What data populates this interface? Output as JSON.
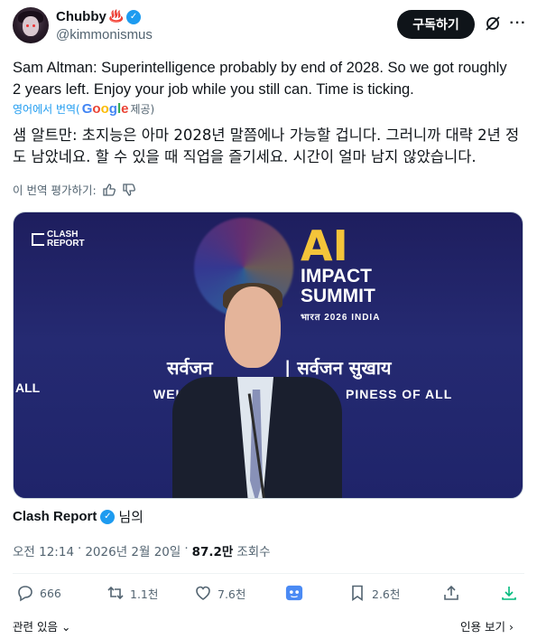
{
  "author": {
    "display_name": "Chubby",
    "name_emoji": "♨️",
    "handle": "@kimmonismus"
  },
  "header": {
    "subscribe_label": "구독하기"
  },
  "tweet": {
    "text": "Sam Altman: Superintelligence probably by end of 2028. So we got roughly 2 years left. Enjoy your job while you still can. Time is ticking.",
    "translated_prefix": "영어에서 번역(",
    "translated_suffix": "제공)",
    "translation": "샘 알트만: 초지능은 아마 2028년 말쯤에나 가능할 겁니다. 그러니까 대략 2년 정도 남았네요. 할 수 있을 때 직업을 즐기세요. 시간이 얼마 남지 않았습니다.",
    "rate_translation": "이 번역 평가하기:"
  },
  "media": {
    "watermark_line1": "CLASH",
    "watermark_line2": "REPORT",
    "summit_ai": "AI",
    "summit_line1": "IMPACT",
    "summit_line2": "SUMMIT",
    "summit_sub": "भारत 2026 INDIA",
    "banner_left": "सर्वजन",
    "banner_right": "| सर्वजन सुखाय",
    "banner_text1": "WEL",
    "banner_text2": "PINESS OF ALL",
    "left_text": "ALL"
  },
  "source": {
    "name": "Clash Report",
    "suffix": "님의"
  },
  "meta": {
    "time": "오전 12:14",
    "separator": "·",
    "date": "2026년 2월 20일",
    "separator2": "·",
    "views": "87.2만",
    "views_label": "조회수"
  },
  "actions": {
    "replies": "666",
    "reposts": "1.1천",
    "likes": "7.6천",
    "bookmarks": "2.6천"
  },
  "footer": {
    "related": "관련 있음",
    "view_quotes": "인용 보기"
  },
  "colors": {
    "accent": "#1d9bf0",
    "text": "#0f1419",
    "muted": "#536471"
  }
}
